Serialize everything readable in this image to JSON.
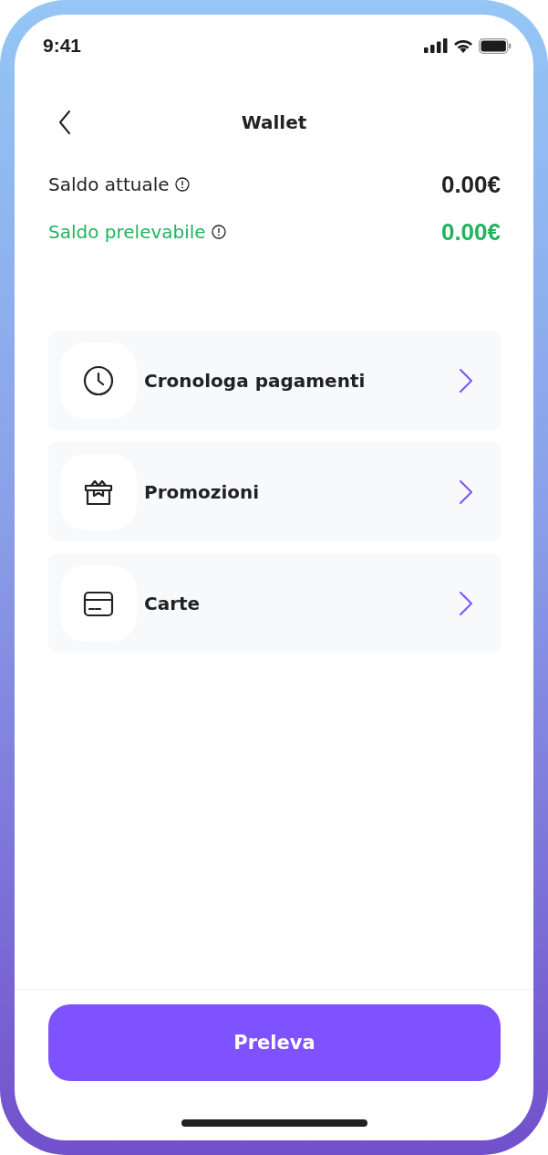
{
  "status_bar": {
    "time": "9:41"
  },
  "header": {
    "title": "Wallet"
  },
  "balances": [
    {
      "label": "Saldo attuale",
      "amount": "0.00€",
      "kind": "current"
    },
    {
      "label": "Saldo prelevabile",
      "amount": "0.00€",
      "kind": "withdrawable"
    }
  ],
  "menu": [
    {
      "label": "Cronologa pagamenti",
      "kind": "history"
    },
    {
      "label": "Promozioni",
      "kind": "promo"
    },
    {
      "label": "Carte",
      "kind": "cards"
    }
  ],
  "primary_button": {
    "label": "Preleva"
  }
}
